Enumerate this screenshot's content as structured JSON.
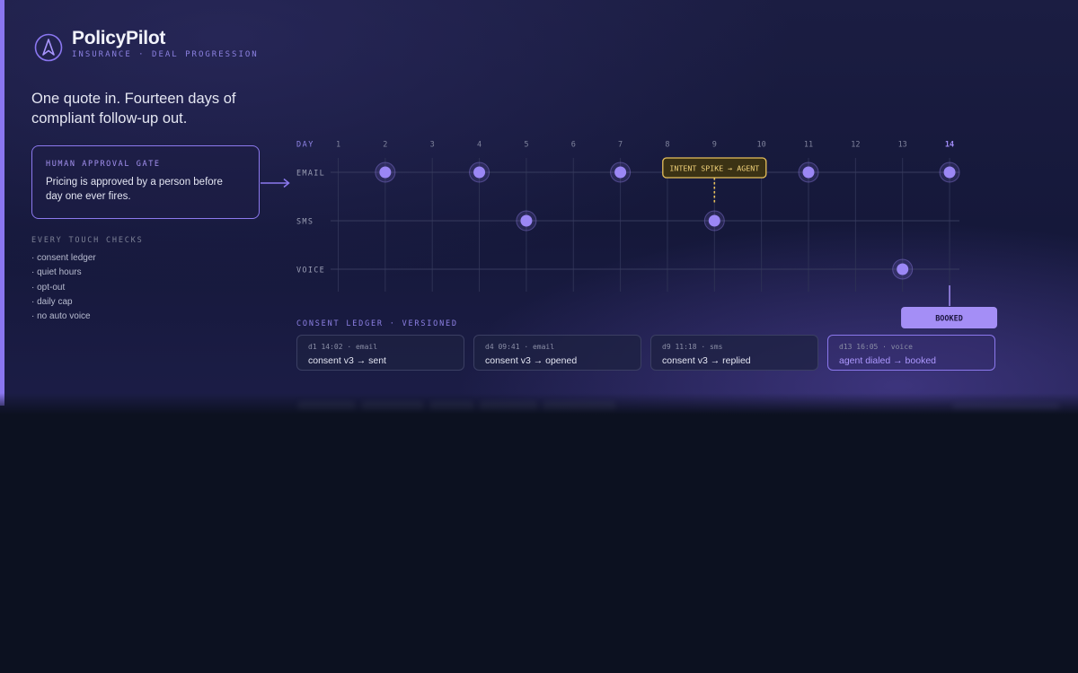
{
  "brand": {
    "name": "PolicyPilot",
    "subtitle": "INSURANCE · DEAL PROGRESSION"
  },
  "headline": "One quote in. Fourteen days of compliant follow-up out.",
  "gate": {
    "title": "HUMAN APPROVAL GATE",
    "body": "Pricing is approved by a person before day one ever fires."
  },
  "checks": {
    "title": "EVERY TOUCH CHECKS",
    "items": [
      "· consent ledger",
      "· quiet hours",
      "· opt-out",
      "· daily cap",
      "· no auto voice"
    ]
  },
  "timeline": {
    "day_label": "DAY",
    "days": [
      1,
      2,
      3,
      4,
      5,
      6,
      7,
      8,
      9,
      10,
      11,
      12,
      13,
      14
    ],
    "current_day": 14,
    "channels": [
      {
        "name": "EMAIL",
        "touch_days": [
          2,
          4,
          7,
          11,
          14
        ]
      },
      {
        "name": "SMS",
        "touch_days": [
          5,
          9
        ]
      },
      {
        "name": "VOICE",
        "touch_days": [
          13
        ]
      }
    ],
    "intent_spike": {
      "label": "INTENT SPIKE → AGENT",
      "day": 9
    },
    "booked": {
      "label": "BOOKED",
      "day": 14
    }
  },
  "ledger": {
    "title": "CONSENT LEDGER · VERSIONED",
    "entries": [
      {
        "meta": "d1 14:02 · email",
        "text": "consent v3 → sent",
        "highlight": false
      },
      {
        "meta": "d4 09:41 · email",
        "text": "consent v3 → opened",
        "highlight": false
      },
      {
        "meta": "d9 11:18 · sms",
        "text": "consent v3 → replied",
        "highlight": false
      },
      {
        "meta": "d13 16:05 · voice",
        "text": "agent dialed → booked",
        "highlight": true
      }
    ]
  },
  "colors": {
    "accent": "#8a76f0",
    "dot": "#9b87f5",
    "spike": "#e8c15a",
    "booked_bg": "#a48ef6",
    "background": "#0c1120"
  },
  "icons": {
    "logo": "compass-a-icon",
    "gate_arrow": "arrow-right-icon"
  }
}
